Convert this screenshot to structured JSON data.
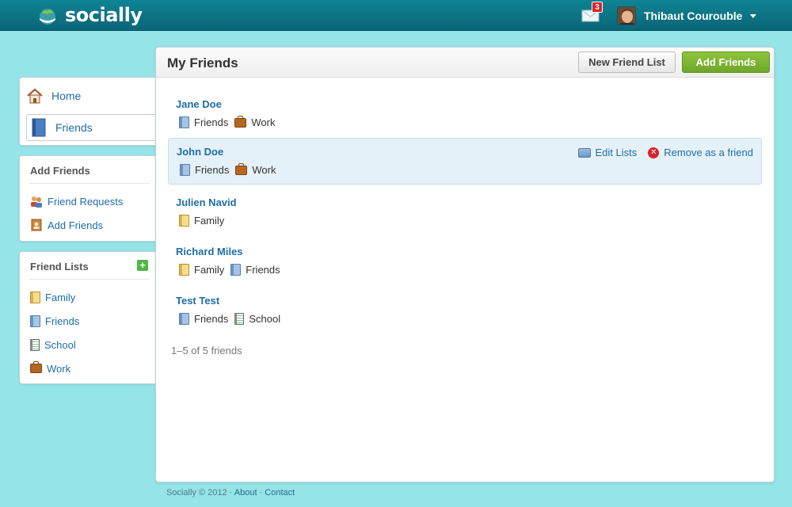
{
  "app": {
    "name": "socially"
  },
  "header": {
    "notification_count": "3",
    "user_name": "Thibaut Courouble"
  },
  "nav": {
    "home_label": "Home",
    "friends_label": "Friends"
  },
  "add_friends_section": {
    "title": "Add Friends",
    "items": [
      {
        "label": "Friend Requests",
        "icon": "people-icon"
      },
      {
        "label": "Add Friends",
        "icon": "address-book-icon"
      }
    ]
  },
  "friend_lists_section": {
    "title": "Friend Lists",
    "add_symbol": "+",
    "items": [
      {
        "label": "Family",
        "icon": "family-list-icon"
      },
      {
        "label": "Friends",
        "icon": "friends-list-icon"
      },
      {
        "label": "School",
        "icon": "school-list-icon"
      },
      {
        "label": "Work",
        "icon": "work-list-icon"
      }
    ]
  },
  "main": {
    "title": "My Friends",
    "new_list_button": "New Friend List",
    "add_friends_button": "Add Friends",
    "friends": [
      {
        "name": "Jane Doe",
        "tags": [
          "Friends",
          "Work"
        ]
      },
      {
        "name": "John Doe",
        "tags": [
          "Friends",
          "Work"
        ],
        "actions": {
          "edit": "Edit Lists",
          "remove": "Remove as a friend"
        }
      },
      {
        "name": "Julien Navid",
        "tags": [
          "Family"
        ]
      },
      {
        "name": "Richard Miles",
        "tags": [
          "Family",
          "Friends"
        ]
      },
      {
        "name": "Test Test",
        "tags": [
          "Friends",
          "School"
        ]
      }
    ],
    "count_text": "1–5 of 5 friends"
  },
  "footer": {
    "copyright": "Socially © 2012",
    "separator": " · ",
    "about": "About",
    "contact": "Contact"
  },
  "colors": {
    "background": "#94e4e8",
    "topbar": "#0a6576",
    "link": "#1e6ea6",
    "add_button": "#7cb432",
    "badge": "#d8262a"
  }
}
